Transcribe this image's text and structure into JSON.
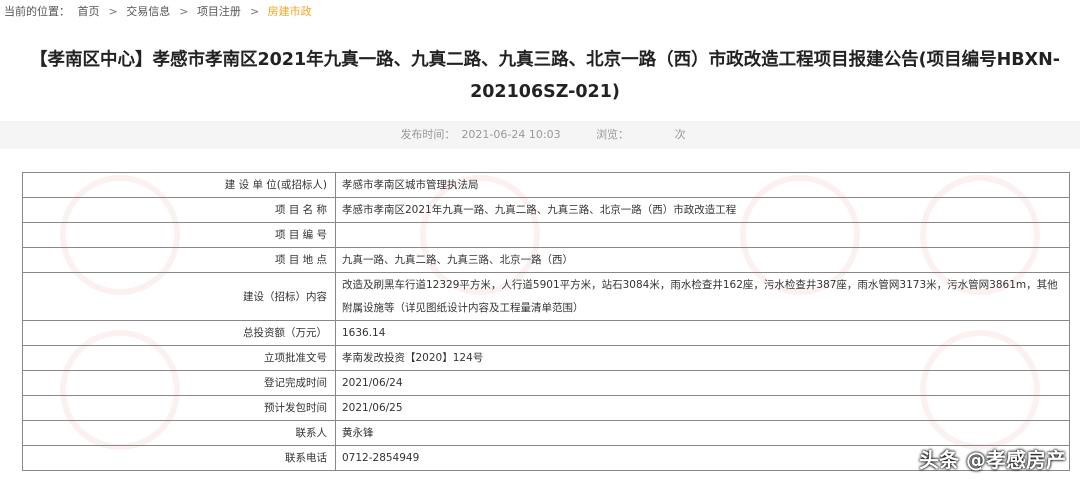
{
  "breadcrumb": {
    "prefix": "当前的位置：",
    "items": [
      "首页",
      "交易信息",
      "项目注册"
    ],
    "current": "房建市政",
    "separator": ">"
  },
  "title": "【孝南区中心】孝感市孝南区2021年九真一路、九真二路、九真三路、北京一路（西）市政改造工程项目报建公告(项目编号HBXN-202106SZ-021)",
  "meta": {
    "publish_label": "发布时间：",
    "publish_time": "2021-06-24 10:03",
    "views_label": "浏览：",
    "views_value": "",
    "views_unit": "次"
  },
  "rows": [
    {
      "label": "建 设 单 位(或招标人)",
      "value": "孝感市孝南区城市管理执法局"
    },
    {
      "label": "项 目 名 称",
      "value": "孝感市孝南区2021年九真一路、九真二路、九真三路、北京一路（西）市政改造工程"
    },
    {
      "label": "项 目 编 号",
      "value": ""
    },
    {
      "label": "项 目 地 点",
      "value": "九真一路、九真二路、九真三路、北京一路（西）"
    },
    {
      "label": "建设（招标）内容",
      "value": "改造及刷黑车行道12329平方米，人行道5901平方米，站石3084米，雨水检查井162座，污水检查井387座，雨水管网3173米，污水管网3861m，其他附属设施等（详见图纸设计内容及工程量清单范围）"
    },
    {
      "label": "总投资额（万元）",
      "value": "1636.14"
    },
    {
      "label": "立项批准文号",
      "value": "孝南发改投资【2020】124号"
    },
    {
      "label": "登记完成时间",
      "value": "2021/06/24"
    },
    {
      "label": "预计发包时间",
      "value": "2021/06/25"
    },
    {
      "label": "联系人",
      "value": "黄永锋"
    },
    {
      "label": "联系电话",
      "value": "0712-2854949"
    }
  ],
  "watermark_brand": "头条 @孝感房产"
}
